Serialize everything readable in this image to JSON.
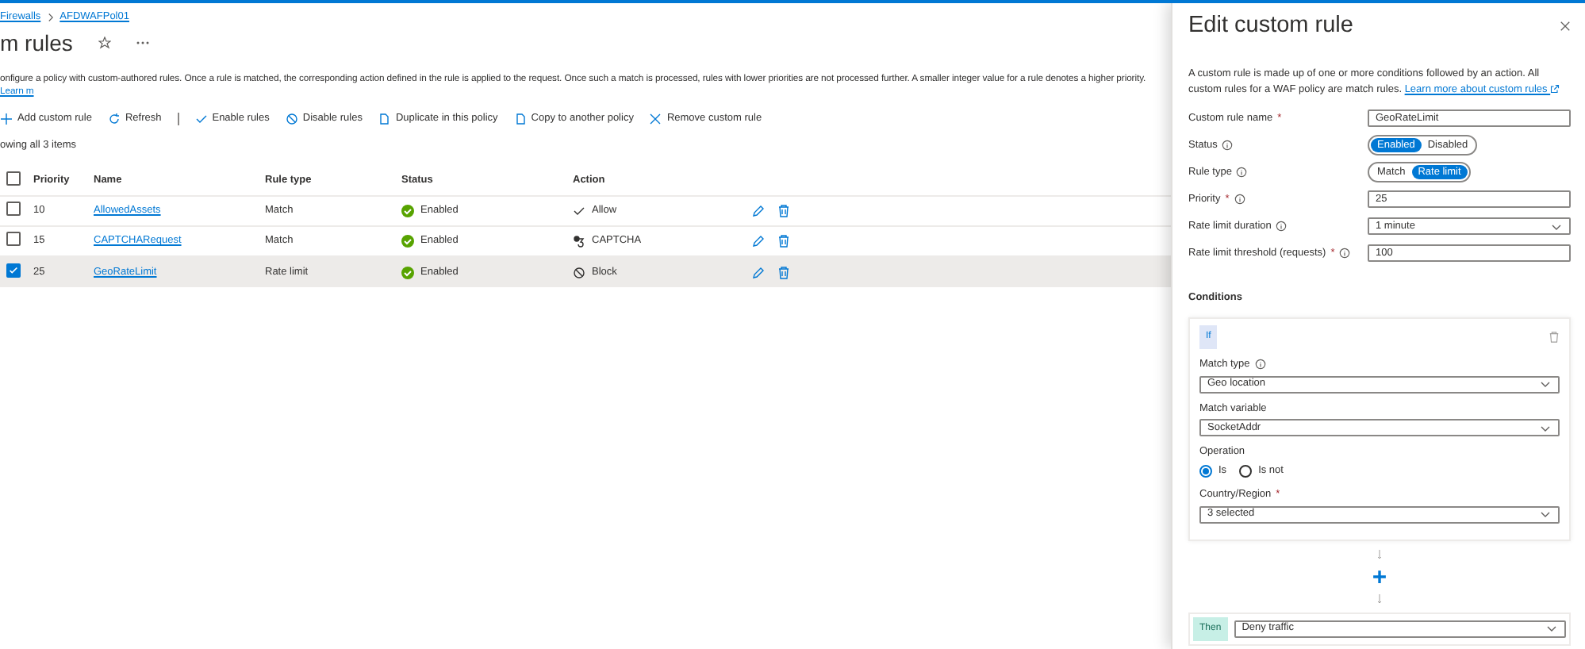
{
  "breadcrumb": [
    "Firewalls",
    "AFDWAFPol01"
  ],
  "page_title": "m rules",
  "description": {
    "text": "onfigure a policy with custom-authored rules. Once a rule is matched, the corresponding action defined in the rule is applied to the request. Once such a match is processed, rules with lower priorities are not processed further. A smaller integer value for a rule denotes a higher priority.",
    "link": "Learn m"
  },
  "toolbar": [
    {
      "kind": "add",
      "label": "Add custom rule"
    },
    {
      "kind": "refresh",
      "label": "Refresh"
    },
    {
      "kind": "separator"
    },
    {
      "kind": "check",
      "label": "Enable rules"
    },
    {
      "kind": "ban",
      "label": "Disable rules"
    },
    {
      "kind": "copy",
      "label": "Duplicate in this policy"
    },
    {
      "kind": "copy",
      "label": "Copy to another policy"
    },
    {
      "kind": "close",
      "label": "Remove custom rule"
    }
  ],
  "item_count": "owing all 3 items",
  "table": {
    "select_all_checked": false,
    "columns": [
      "Priority",
      "Name",
      "Rule type",
      "Status",
      "Action"
    ],
    "rows": [
      {
        "selected": false,
        "priority": "10",
        "name": "AllowedAssets",
        "rule_type": "Match",
        "status": "Enabled",
        "action": {
          "kind": "allow",
          "label": "Allow"
        }
      },
      {
        "selected": false,
        "priority": "15",
        "name": "CAPTCHARequest",
        "rule_type": "Match",
        "status": "Enabled",
        "action": {
          "kind": "captcha",
          "label": "CAPTCHA"
        }
      },
      {
        "selected": true,
        "priority": "25",
        "name": "GeoRateLimit",
        "rule_type": "Rate limit",
        "status": "Enabled",
        "action": {
          "kind": "block",
          "label": "Block"
        }
      }
    ]
  },
  "panel": {
    "title": "Edit custom rule",
    "description": {
      "text": "A custom rule is made up of one or more conditions followed by an action. All custom rules for a WAF policy are match rules.",
      "link": "Learn more about custom rules"
    },
    "fields": [
      {
        "kind": "text",
        "label": "Custom rule name",
        "required_mark": "*",
        "value": "GeoRateLimit"
      },
      {
        "kind": "toggle",
        "label": "Status",
        "info": true,
        "options": [
          {
            "label": "Enabled",
            "selected": true
          },
          {
            "label": "Disabled",
            "selected": false
          }
        ]
      },
      {
        "kind": "toggle",
        "label": "Rule type",
        "info": true,
        "options": [
          {
            "label": "Match",
            "selected": false
          },
          {
            "label": "Rate limit",
            "selected": true
          }
        ]
      },
      {
        "kind": "text",
        "label": "Priority",
        "required_mark": "*",
        "info": true,
        "value": "25"
      },
      {
        "kind": "select",
        "label": "Rate limit duration",
        "info": true,
        "value": "1 minute"
      },
      {
        "kind": "text",
        "label": "Rate limit threshold (requests)",
        "required_mark": "*",
        "info": true,
        "value": "100"
      }
    ],
    "conditions": {
      "title": "Conditions",
      "if_label": "If",
      "fields": [
        {
          "kind": "select",
          "label": "Match type",
          "info": true,
          "value": "Geo location"
        },
        {
          "kind": "select",
          "label": "Match variable",
          "value": "SocketAddr"
        },
        {
          "kind": "radio",
          "label": "Operation",
          "options": [
            {
              "label": "Is",
              "selected": true
            },
            {
              "label": "Is not",
              "selected": false
            }
          ]
        },
        {
          "kind": "select",
          "label": "Country/Region",
          "required_mark": "*",
          "value": "3 selected"
        }
      ]
    },
    "then_label": "Then",
    "then_value": "Deny traffic"
  }
}
